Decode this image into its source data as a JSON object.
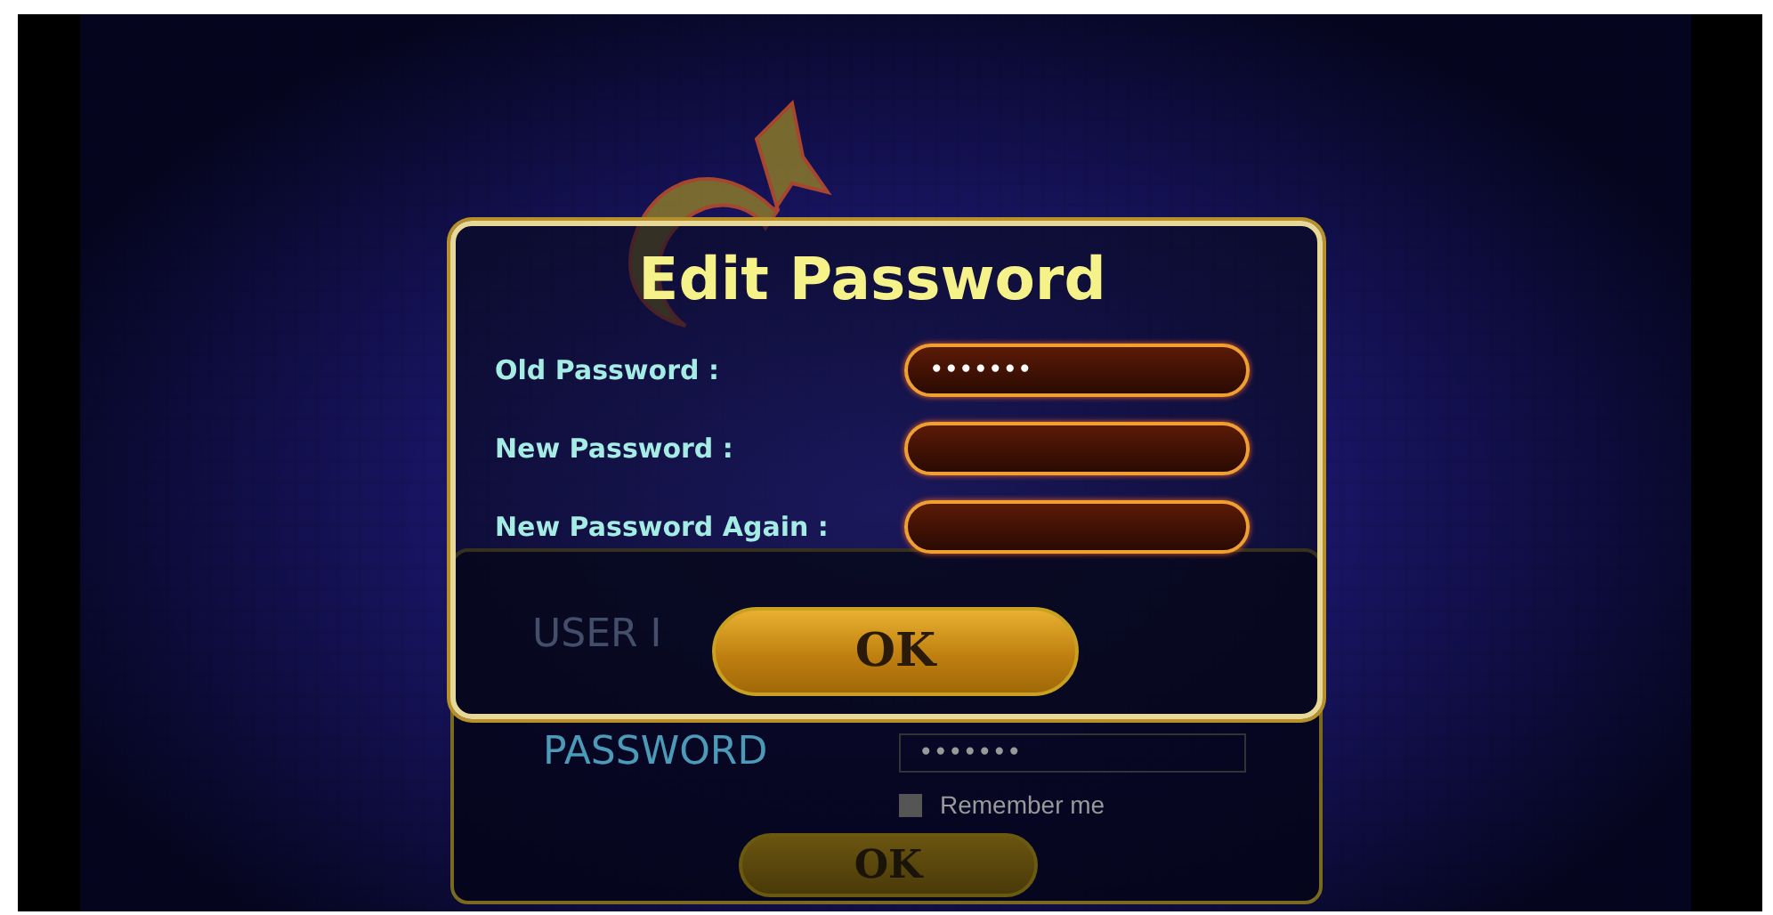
{
  "login_panel": {
    "user_label": "USER I",
    "password_label": "PASSWORD",
    "password_value": "•••••••",
    "remember_me": {
      "label": "Remember me",
      "checked": false
    },
    "ok_button": "OK"
  },
  "dialog": {
    "title": "Edit Password",
    "fields": [
      {
        "label": "Old Password :",
        "value": "•••••••"
      },
      {
        "label": "New Password :"
      },
      {
        "label": "New Password Again :"
      }
    ],
    "ok_button": "OK"
  }
}
